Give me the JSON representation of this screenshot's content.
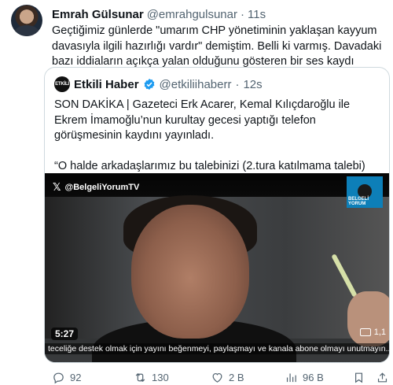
{
  "author": {
    "name": "Emrah Gülsunar",
    "handle": "@emrahgulsunar",
    "time": "11s",
    "text": "Geçtiğimiz günlerde \"umarım CHP yönetiminin yaklaşan kayyum davasıyla ilgili hazırlığı vardır\" demiştim. Belli ki varmış. Davadaki bazı iddiaların açıkça yalan olduğunu gösteren bir ses kaydı yayınlandı."
  },
  "quote": {
    "name": "Etkili Haber",
    "handle": "@etkiliihaberr",
    "time": "12s",
    "avatar_text": "ETKİLİ",
    "text1": "SON DAKİKA | Gazeteci Erk Acarer, Kemal Kılıçdaroğlu ile Ekrem İmamoğlu’nun kurultay gecesi yaptığı telefon görüşmesinin kaydını yayınladı.",
    "text2": "“O halde arkadaşlarımız bu talebinizi (2.tura katılmama talebi) İlçe ...",
    "video": {
      "watermark": "@BelgeliYorumTV",
      "logo_text": "BELGELİ YORUM",
      "ticker": "teceliğe destek olmak için yayını beğenmeyi, paylaşmayı ve kanala abone olmayı unutmayın...",
      "duration": "5:27",
      "views": "1,1"
    }
  },
  "actions": {
    "replies": "92",
    "reposts": "130",
    "likes": "2 B",
    "views": "96 B"
  },
  "colors": {
    "verified": "#1d9bf0",
    "muted": "#536471",
    "border": "#cfd9de"
  }
}
